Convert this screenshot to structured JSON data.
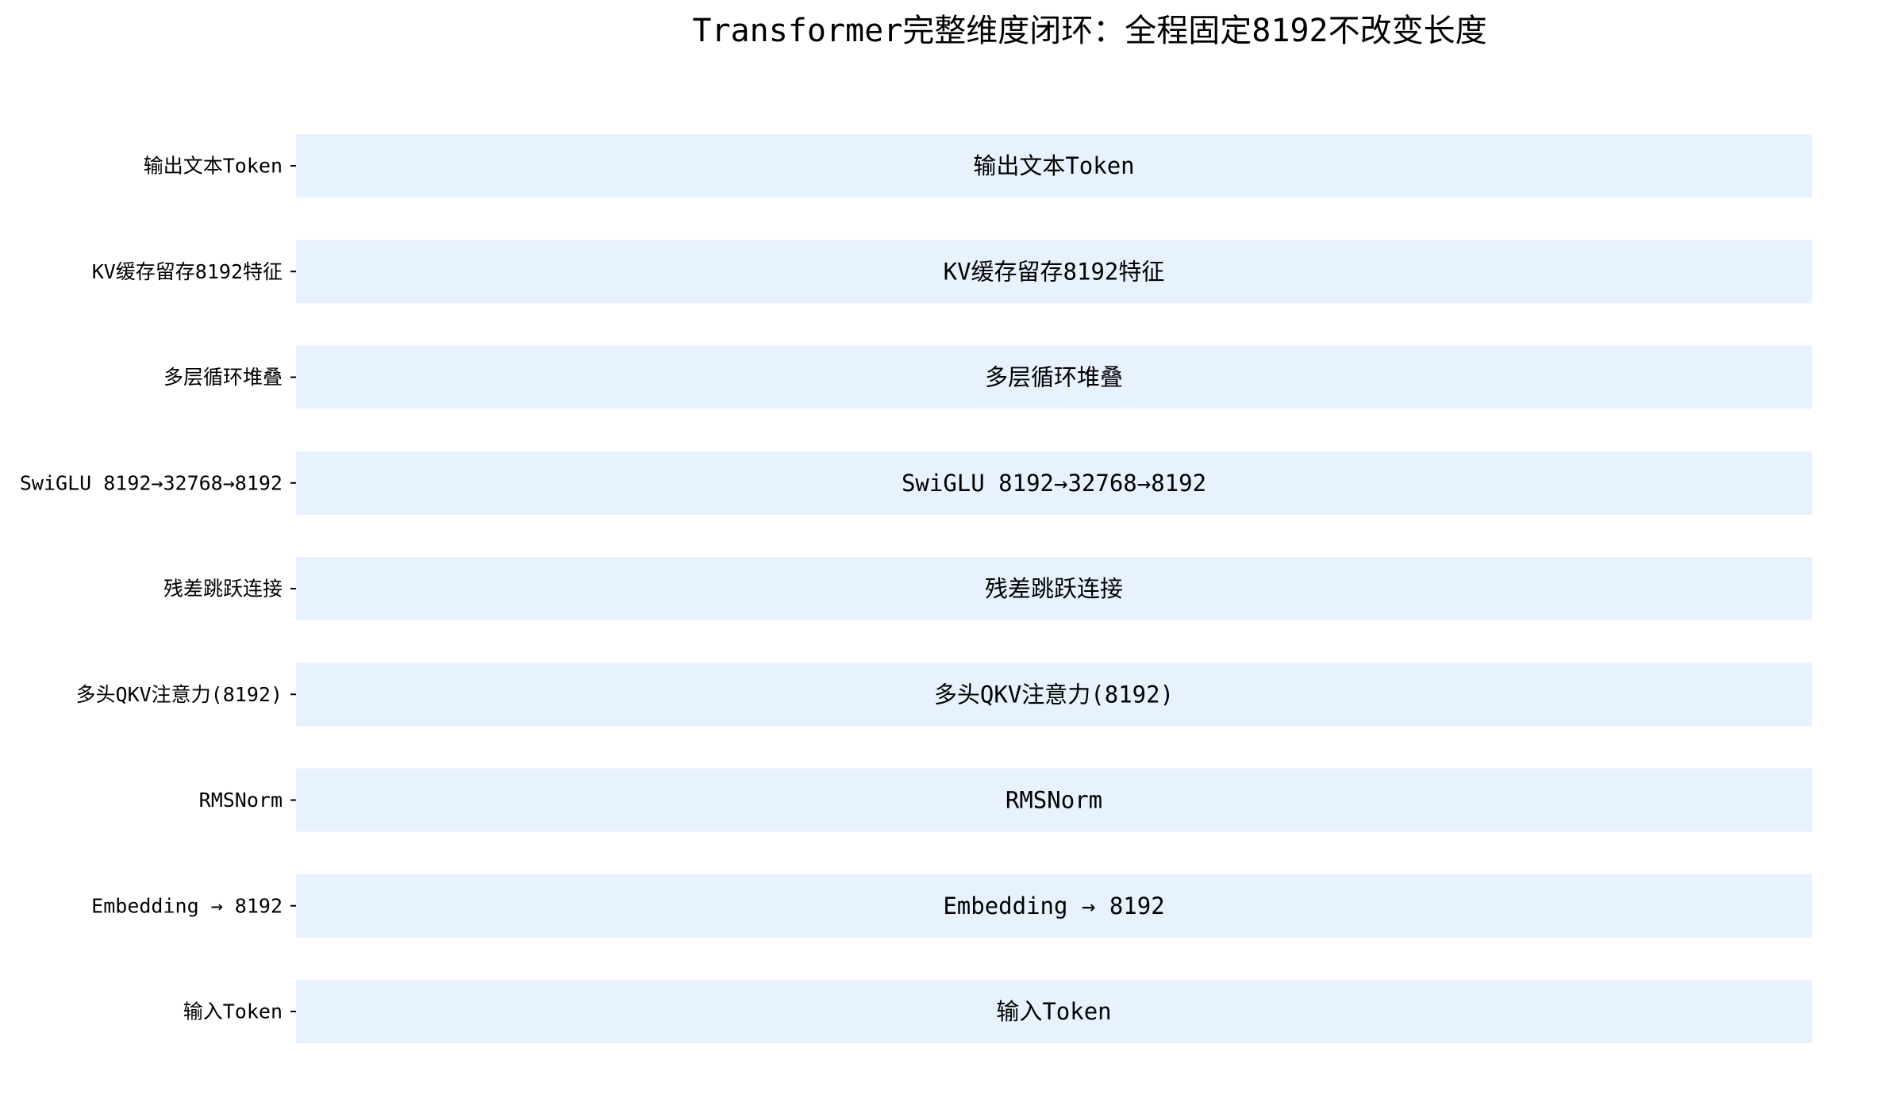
{
  "chart_data": {
    "type": "bar",
    "title": "Transformer完整维度闭环：全程固定8192不改变长度",
    "xlabel": "",
    "ylabel": "",
    "orientation": "horizontal",
    "categories": [
      "输入Token",
      "Embedding → 8192",
      "RMSNorm",
      "多头QKV注意力(8192)",
      "残差跳跃连接",
      "SwiGLU 8192→32768→8192",
      "多层循环堆叠",
      "KV缓存留存8192特征",
      "输出文本Token"
    ],
    "values": [
      1,
      1,
      1,
      1,
      1,
      1,
      1,
      1,
      1
    ],
    "data_labels": [
      "输入Token",
      "Embedding → 8192",
      "RMSNorm",
      "多头QKV注意力(8192)",
      "残差跳跃连接",
      "SwiGLU 8192→32768→8192",
      "多层循环堆叠",
      "KV缓存留存8192特征",
      "输出文本Token"
    ],
    "xlim": [
      0,
      1
    ],
    "grid": false,
    "legend": "none",
    "bar_color": "#e8f2fe",
    "axis_color": "#000000"
  }
}
